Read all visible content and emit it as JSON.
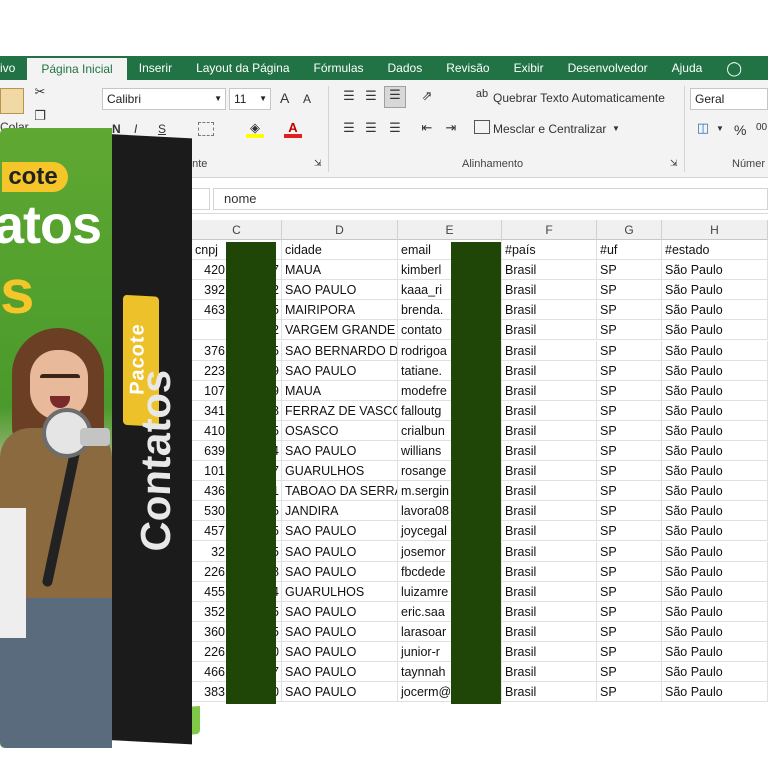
{
  "menu": {
    "tabs": [
      "ivo",
      "Página Inicial",
      "Inserir",
      "Layout da Página",
      "Fórmulas",
      "Dados",
      "Revisão",
      "Exibir",
      "Desenvolvedor",
      "Ajuda"
    ],
    "active": "Página Inicial"
  },
  "ribbon": {
    "paste_label": "Colar",
    "font_name": "Calibri",
    "font_size": "11",
    "grow_font": "A",
    "shrink_font": "A",
    "bold": "N",
    "italic": "I",
    "underline": "S",
    "font_group_label": "onte",
    "wrap_text": "Quebrar Texto Automaticamente",
    "merge_center": "Mesclar e Centralizar",
    "alignment_group_label": "Alinhamento",
    "number_format": "Geral",
    "percent": "%",
    "thousands": "00",
    "number_group_label": "Númer"
  },
  "formula_bar": {
    "value": "nome"
  },
  "columns": [
    {
      "letter": "C",
      "header": "cnpj"
    },
    {
      "letter": "D",
      "header": "cidade"
    },
    {
      "letter": "E",
      "header": "email"
    },
    {
      "letter": "F",
      "header": "#país"
    },
    {
      "letter": "G",
      "header": "#uf"
    },
    {
      "letter": "H",
      "header": "#estado"
    }
  ],
  "rows": [
    {
      "cnpj": "420",
      "cnpj_end": "7",
      "cidade": "MAUA",
      "email": "kimberl",
      "pais": "Brasil",
      "uf": "SP",
      "estado": "São Paulo"
    },
    {
      "cnpj": "392",
      "cnpj_end": "2",
      "cidade": "SAO PAULO",
      "email": "kaaa_ri",
      "pais": "Brasil",
      "uf": "SP",
      "estado": "São Paulo"
    },
    {
      "cnpj": "463",
      "cnpj_end": "5",
      "cidade": "MAIRIPORA",
      "email": "brenda.",
      "pais": "Brasil",
      "uf": "SP",
      "estado": "São Paulo"
    },
    {
      "cnpj": "",
      "cnpj_end": "2",
      "cidade": "VARGEM GRANDE",
      "email": "contato",
      "pais": "Brasil",
      "uf": "SP",
      "estado": "São Paulo"
    },
    {
      "cnpj": "376",
      "cnpj_end": "5",
      "cidade": "SAO BERNARDO D",
      "email": "rodrigoa",
      "pais": "Brasil",
      "uf": "SP",
      "estado": "São Paulo"
    },
    {
      "cnpj": "223",
      "cnpj_end": "9",
      "cidade": "SAO PAULO",
      "email": "tatiane.",
      "pais": "Brasil",
      "uf": "SP",
      "estado": "São Paulo"
    },
    {
      "cnpj": "107",
      "cnpj_end": "9",
      "cidade": "MAUA",
      "email": "modefre",
      "pais": "Brasil",
      "uf": "SP",
      "estado": "São Paulo"
    },
    {
      "cnpj": "341",
      "cnpj_end": "8",
      "cidade": "FERRAZ DE VASCO",
      "email": "falloutg",
      "pais": "Brasil",
      "uf": "SP",
      "estado": "São Paulo"
    },
    {
      "cnpj": "410",
      "cnpj_end": "5",
      "cidade": "OSASCO",
      "email": "crialbun",
      "pais": "Brasil",
      "uf": "SP",
      "estado": "São Paulo"
    },
    {
      "cnpj": "639",
      "cnpj_end": "4",
      "cidade": "SAO PAULO",
      "email": "willians",
      "pais": "Brasil",
      "uf": "SP",
      "estado": "São Paulo"
    },
    {
      "cnpj": "101",
      "cnpj_end": "7",
      "cidade": "GUARULHOS",
      "email": "rosange",
      "pais": "Brasil",
      "uf": "SP",
      "estado": "São Paulo"
    },
    {
      "cnpj": "436",
      "cnpj_end": "1",
      "cidade": "TABOAO DA SERRA",
      "email": "m.sergin",
      "pais": "Brasil",
      "uf": "SP",
      "estado": "São Paulo"
    },
    {
      "cnpj": "530",
      "cnpj_end": "5",
      "cidade": "JANDIRA",
      "email": "lavora08",
      "pais": "Brasil",
      "uf": "SP",
      "estado": "São Paulo"
    },
    {
      "cnpj": "457",
      "cnpj_end": "5",
      "cidade": "SAO PAULO",
      "email": "joycegal",
      "pais": "Brasil",
      "uf": "SP",
      "estado": "São Paulo"
    },
    {
      "cnpj": "32",
      "cnpj_end": "5",
      "cidade": "SAO PAULO",
      "email": "josemor",
      "pais": "Brasil",
      "uf": "SP",
      "estado": "São Paulo"
    },
    {
      "cnpj": "226",
      "cnpj_end": "8",
      "cidade": "SAO PAULO",
      "email": "fbcdede",
      "pais": "Brasil",
      "uf": "SP",
      "estado": "São Paulo"
    },
    {
      "cnpj": "455",
      "cnpj_end": "4",
      "cidade": "GUARULHOS",
      "email": "luizamre",
      "pais": "Brasil",
      "uf": "SP",
      "estado": "São Paulo"
    },
    {
      "cnpj": "352",
      "cnpj_end": "5",
      "cidade": "SAO PAULO",
      "email": "eric.saa",
      "pais": "Brasil",
      "uf": "SP",
      "estado": "São Paulo"
    },
    {
      "cnpj": "360",
      "cnpj_end": "5",
      "cidade": "SAO PAULO",
      "email": "larasoar",
      "pais": "Brasil",
      "uf": "SP",
      "estado": "São Paulo"
    },
    {
      "cnpj": "226",
      "cnpj_end": "0",
      "cidade": "SAO PAULO",
      "email": "junior-r",
      "pais": "Brasil",
      "uf": "SP",
      "estado": "São Paulo"
    },
    {
      "cnpj": "466",
      "cnpj_end": "7",
      "cidade": "SAO PAULO",
      "email": "taynnah",
      "pais": "Brasil",
      "uf": "SP",
      "estado": "São Paulo"
    },
    {
      "cnpj": "383",
      "cnpj_end": "0",
      "cidade": "SAO PAULO",
      "email": "jocerm@",
      "pais": "Brasil",
      "uf": "SP",
      "estado": "São Paulo"
    }
  ],
  "product": {
    "front_pacote": "cote",
    "front_contatos": "atos",
    "front_ss": "s",
    "side_pacote": "Pacote",
    "side_contatos": "Contatos"
  },
  "colors": {
    "excel_green": "#217346",
    "redaction": "#1f4507",
    "box_green": "#5fa832",
    "box_yellow": "#f5c629"
  },
  "icons": {
    "lightbulb": "lightbulb-icon",
    "paste": "paste-icon",
    "cut": "scissors-icon",
    "copy": "copy-icon"
  }
}
